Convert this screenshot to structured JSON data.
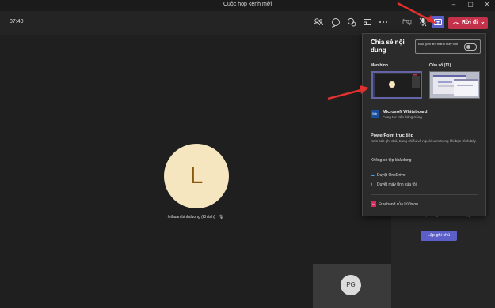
{
  "window": {
    "title": "Cuộc họp kênh mới"
  },
  "toolbar": {
    "timer": "07:40",
    "leave_label": "Rời đi"
  },
  "stage": {
    "participant_initial": "L",
    "participant_name": "lethuan.binhduong (Khách)",
    "self_initials": "PG"
  },
  "right_panel": {
    "text": "trước, trong và sau cuộc họp.",
    "button_label": "Lập ghi chú"
  },
  "share_popup": {
    "title": "Chia sẻ nội dung",
    "toggle_label": "Bao gồm âm thanh máy tính",
    "toggle_on": false,
    "screen_label": "Màn hình",
    "window_label": "Cửa sổ (11)",
    "whiteboard": {
      "title": "Microsoft Whiteboard",
      "subtitle": "Cộng tác trên bảng trắng",
      "logo_text": "Wb"
    },
    "powerpoint": {
      "title": "PowerPoint trực tiếp",
      "subtitle": "Xem các ghi chú, trang chiếu và người xem trong khi bạn trình bày"
    },
    "no_files": "Không có tệp khả dụng",
    "browse_onedrive": "Duyệt OneDrive",
    "browse_computer": "Duyệt máy tính của tôi",
    "freehand": "Freehand của InVision",
    "freehand_logo": "In"
  },
  "colors": {
    "accent": "#5b5fc7",
    "leave": "#c4314b",
    "avatar_bg": "#f5e6bf",
    "arrow": "#e03030"
  }
}
